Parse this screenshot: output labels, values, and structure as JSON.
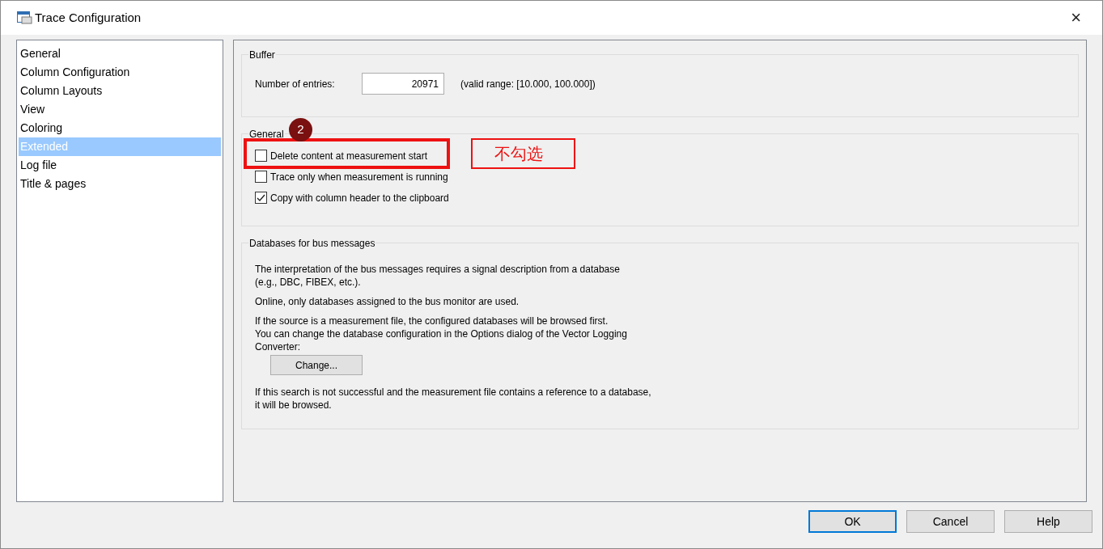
{
  "window": {
    "title": "Trace Configuration",
    "close": "×"
  },
  "sidebar": {
    "items": [
      {
        "label": "General",
        "selected": false
      },
      {
        "label": "Column Configuration",
        "selected": false
      },
      {
        "label": "Column Layouts",
        "selected": false
      },
      {
        "label": "View",
        "selected": false
      },
      {
        "label": "Coloring",
        "selected": false
      },
      {
        "label": "Extended",
        "selected": true
      },
      {
        "label": "Log file",
        "selected": false
      },
      {
        "label": "Title & pages",
        "selected": false
      }
    ]
  },
  "buffer": {
    "title": "Buffer",
    "label": "Number of entries:",
    "value": "20971",
    "hint": "(valid range: [10.000, 100.000])"
  },
  "general": {
    "title": "General",
    "options": [
      {
        "label": "Delete content at measurement start",
        "checked": false
      },
      {
        "label": "Trace only when measurement is running",
        "checked": false
      },
      {
        "label": "Copy with column header to the clipboard",
        "checked": true
      }
    ]
  },
  "databases": {
    "title": "Databases for bus messages",
    "paragraphs": [
      "The interpretation of the bus messages requires a signal description from a database\n(e.g., DBC, FIBEX, etc.).",
      "Online, only databases assigned to the bus monitor are used.",
      "If the source is a measurement file, the configured databases will be browsed first.\nYou can change the database configuration in the Options dialog of the Vector Logging\nConverter:"
    ],
    "button": "Change...",
    "note": "If this search is not successful and the measurement file contains a reference to a database,\nit will be browsed."
  },
  "annotations": {
    "badge": "2",
    "note": "不勾选"
  },
  "buttons": [
    {
      "label": "OK",
      "selected": true
    },
    {
      "label": "Cancel",
      "selected": false
    },
    {
      "label": "Help",
      "selected": false
    }
  ]
}
